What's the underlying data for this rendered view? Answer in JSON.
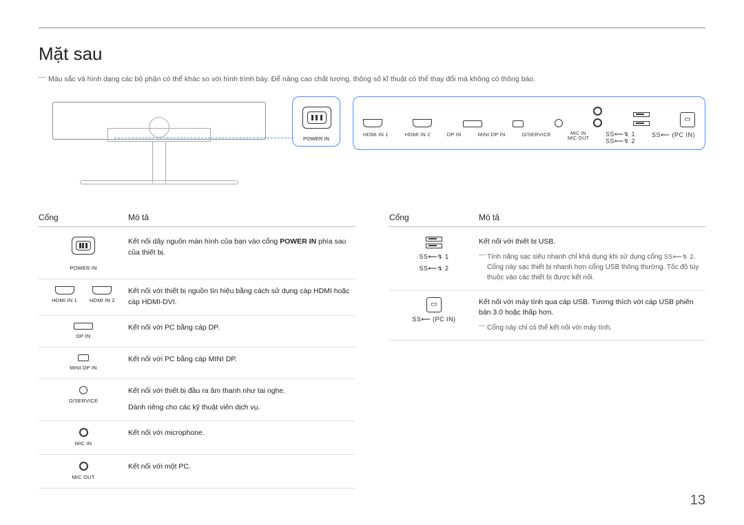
{
  "page_number": "13",
  "title": "Mặt sau",
  "top_note": "Màu sắc và hình dạng các bộ phận có thể khác so với hình trình bày. Để nâng cao chất lượng, thông số kĩ thuật có thể thay đổi mà không có thông báo.",
  "diagram": {
    "power_label": "POWER IN",
    "ports": {
      "hdmi1": "HDMI IN 1",
      "hdmi2": "HDMI IN 2",
      "dp": "DP IN",
      "minidp": "MINI DP IN",
      "service": "Ω/SERVICE",
      "mic_in": "MIC IN",
      "mic_out": "MIC OUT",
      "usb1": "SS⟵↯ 1",
      "usb2": "SS⟵↯ 2",
      "pcin": "SS⟵ (PC IN)"
    }
  },
  "headers": {
    "port": "Cổng",
    "desc": "Mô tả"
  },
  "left": [
    {
      "icon": "power",
      "label": "POWER IN",
      "desc_pre": "Kết nối dây nguồn màn hình của bạn vào cổng ",
      "desc_bold": "POWER IN",
      "desc_post": " phía sau của thiết bị."
    },
    {
      "icon": "hdmi-pair",
      "label_a": "HDMI IN 1",
      "label_b": "HDMI IN 2",
      "desc": "Kết nối với thiết bị nguồn tín hiệu bằng cách sử dụng cáp HDMI hoặc cáp HDMI-DVI."
    },
    {
      "icon": "dp",
      "label": "DP IN",
      "desc": "Kết nối với PC bằng cáp DP."
    },
    {
      "icon": "minidp",
      "label": "MINI DP IN",
      "desc": "Kết nối với PC bằng cáp MINI DP."
    },
    {
      "icon": "jack",
      "label": "Ω/SERVICE",
      "desc": "Kết nối với thiết bị đầu ra âm thanh như tai nghe.",
      "desc2": "Dành riêng cho các kỹ thuật viên dịch vụ."
    },
    {
      "icon": "jack-b",
      "label": "MIC IN",
      "desc": "Kết nối với microphone."
    },
    {
      "icon": "jack-b",
      "label": "MIC OUT",
      "desc": "Kết nối với một PC."
    }
  ],
  "right": [
    {
      "icon": "usb-stack",
      "label_a": "SS⟵↯ 1",
      "label_b": "SS⟵↯ 2",
      "desc": "Kết nối với thiết bị USB.",
      "note_pre": "Tính năng sạc siêu nhanh chỉ khả dụng khi sử dụng cổng ",
      "note_mid": "SS⟵↯ 2",
      "note_post": ". Cổng này sạc thiết bị nhanh hơn cổng USB thông thường. Tốc độ tùy thuộc vào các thiết bị được kết nối."
    },
    {
      "icon": "usbb",
      "label": "SS⟵ (PC IN)",
      "desc": "Kết nối với máy tính qua cáp USB. Tương thích với cáp USB phiên bản 3.0 hoặc thấp hơn.",
      "note": "Cổng này chỉ có thể kết nối với máy tính."
    }
  ]
}
